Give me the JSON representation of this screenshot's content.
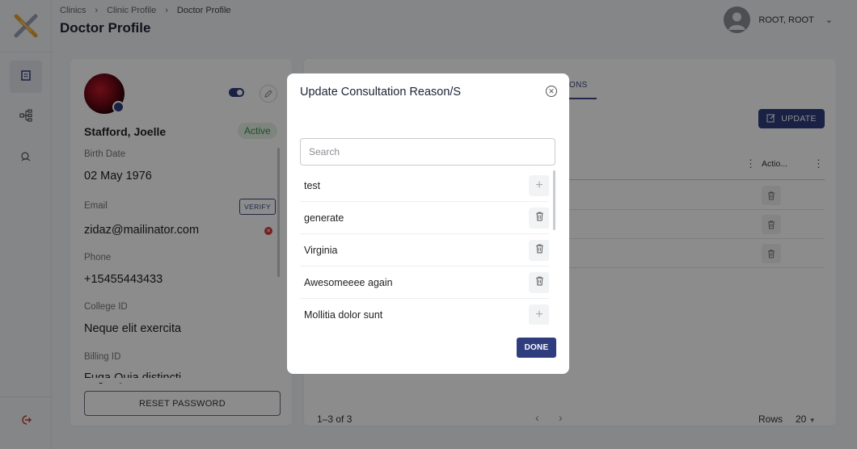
{
  "header": {
    "breadcrumbs": [
      "Clinics",
      "Clinic Profile",
      "Doctor Profile"
    ],
    "title": "Doctor Profile",
    "user_name": "ROOT, ROOT"
  },
  "profile": {
    "name": "Stafford, Joelle",
    "status": "Active",
    "fields": [
      {
        "label": "Birth Date",
        "value": "02 May 1976"
      },
      {
        "label": "Email",
        "value": "zidaz@mailinator.com"
      },
      {
        "label": "Phone",
        "value": "+15455443433"
      },
      {
        "label": "College ID",
        "value": "Neque elit exercita"
      },
      {
        "label": "Billing ID",
        "value": "Fuga Quia distincti"
      }
    ],
    "verify_label": "VERIFY",
    "reset_label": "RESET PASSWORD"
  },
  "right": {
    "tab_fragment": "ONS",
    "update_label": "UPDATE",
    "actions_header": "Actio...",
    "pager_info": "1–3 of 3",
    "rows_label": "Rows",
    "rows_value": "20"
  },
  "modal": {
    "title": "Update Consultation Reason/S",
    "search_placeholder": "Search",
    "items": [
      {
        "label": "test",
        "action": "add"
      },
      {
        "label": "generate",
        "action": "delete"
      },
      {
        "label": "Virginia",
        "action": "delete"
      },
      {
        "label": "Awesomeeee again",
        "action": "delete"
      },
      {
        "label": "Mollitia dolor sunt",
        "action": "add"
      }
    ],
    "done_label": "DONE"
  },
  "colors": {
    "primary": "#2f3d7e",
    "active_badge_bg": "#e3f3e6",
    "active_badge_text": "#3f8b4a",
    "error": "#d33a3a"
  }
}
